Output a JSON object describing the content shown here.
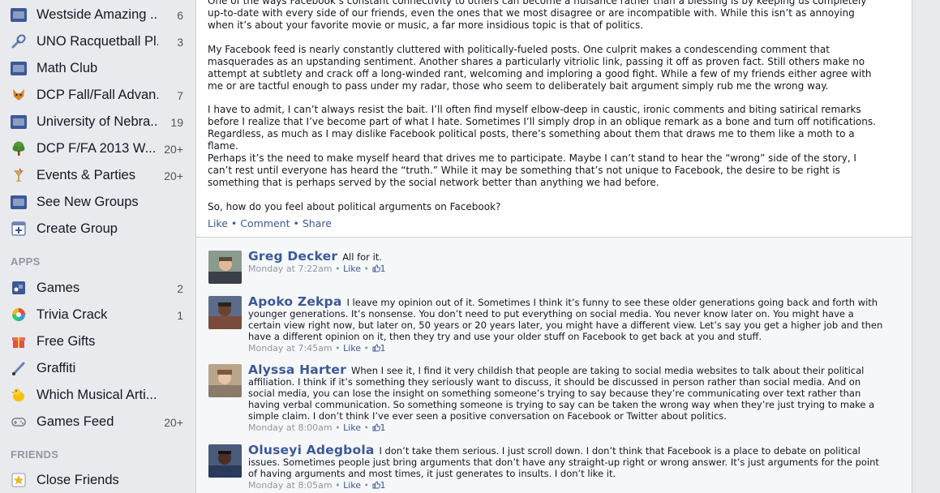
{
  "sidebar": {
    "groups": [
      {
        "label": "Westside Amazing ...",
        "count": "6",
        "icon": "group-icon"
      },
      {
        "label": "UNO Racquetball Pl...",
        "count": "3",
        "icon": "racquet-icon"
      },
      {
        "label": "Math Club",
        "count": "",
        "icon": "group-icon"
      },
      {
        "label": "DCP Fall/Fall Advan...",
        "count": "7",
        "icon": "fox-icon"
      },
      {
        "label": "University of Nebra...",
        "count": "19",
        "icon": "group-icon"
      },
      {
        "label": "DCP F/FA 2013 W...",
        "count": "20+",
        "icon": "tree-icon"
      },
      {
        "label": "Events & Parties",
        "count": "20+",
        "icon": "cup-icon"
      },
      {
        "label": "See New Groups",
        "count": "",
        "icon": "group-icon"
      },
      {
        "label": "Create Group",
        "count": "",
        "icon": "plus-icon"
      }
    ],
    "apps_header": "APPS",
    "apps": [
      {
        "label": "Games",
        "count": "2",
        "icon": "games-icon"
      },
      {
        "label": "Trivia Crack",
        "count": "1",
        "icon": "trivia-icon"
      },
      {
        "label": "Free Gifts",
        "count": "",
        "icon": "gift-icon"
      },
      {
        "label": "Graffiti",
        "count": "",
        "icon": "brush-icon"
      },
      {
        "label": "Which Musical Arti...",
        "count": "",
        "icon": "bird-icon"
      },
      {
        "label": "Games Feed",
        "count": "20+",
        "icon": "controller-icon"
      }
    ],
    "friends_header": "FRIENDS",
    "friends": [
      {
        "label": "Close Friends",
        "count": "",
        "icon": "star-icon"
      }
    ]
  },
  "post": {
    "paragraphs": [
      "One of the ways Facebook’s constant connectivity to others can become a nuisance rather than a blessing is by keeping us completely up-to-date with every side of our friends, even the ones that we most disagree or are incompatible with. While this isn’t as annoying when it’s about your favorite movie or music, a far more insidious topic is that of politics.",
      "My Facebook feed is nearly constantly cluttered with politically-fueled posts. One culprit makes a condescending comment that masquerades as an upstanding sentiment. Another shares a particularly vitriolic link, passing it off as proven fact. Still others make no attempt at subtlety and crack off a long-winded rant, welcoming and imploring a good fight. While a few of my friends either agree with me or are tactful enough to pass under my radar, those who seem to deliberately bait argument simply rub me the wrong way.",
      "I have to admit, I can’t always resist the bait. I’ll often find myself elbow-deep in caustic, ironic comments and biting satirical remarks before I realize that I’ve become part of what I hate. Sometimes I’ll simply drop in an oblique remark as a bone and turn off notifications. Regardless, as much as I may dislike Facebook political posts, there’s something about them that draws me to them like a moth to a flame.",
      "Perhaps it’s the need to make myself heard that drives me to participate. Maybe I can’t stand to hear the “wrong” side of the story, I can’t rest until everyone has heard the “truth.” While it may be something that’s not unique to Facebook, the desire to be right is something that is perhaps served by the social network better than anything we had before.",
      "So, how do you feel about political arguments on Facebook?"
    ],
    "like": "Like",
    "comment": "Comment",
    "share": "Share",
    "separator": "•"
  },
  "comments": [
    {
      "name": "Greg Decker",
      "text": "All for it.",
      "time": "Monday at 7:22am",
      "like": "Like",
      "likes": "1"
    },
    {
      "name": "Apoko Zekpa",
      "text": "I leave my opinion out of it. Sometimes I think it’s funny to see these older generations going back and forth with younger generations. It’s nonsense. You don’t need to put everything on social media. You never know later on. You might have a certain view right now, but later on, 50 years or 20 years later, you might have a different view. Let’s say you get a higher job and then have a different opinion on it, then they try and use your older stuff on Facebook to get back at you and stuff.",
      "time": "Monday at 7:45am",
      "like": "Like",
      "likes": "1"
    },
    {
      "name": "Alyssa Harter",
      "text": "When I see it, I find it very childish that people are taking to social media websites to talk about their political affiliation. I think if it’s something they seriously want to discuss, it should be discussed in person rather than social media. And on social media, you can lose the insight on something someone’s trying to say because they’re communicating over text rather than having verbal communication. So something someone is trying to say can be taken the wrong way when they’re just trying to make a simple claim. I don’t think I’ve ever seen a positive conversation on Facebook or Twitter about politics.",
      "time": "Monday at 8:00am",
      "like": "Like",
      "likes": "1"
    },
    {
      "name": "Oluseyi Adegbola",
      "text": "I don’t take them serious. I just scroll down. I don’t think that Facebook is a place to debate on political issues. Sometimes people just bring arguments that don’t have any straight-up right or wrong answer. It’s just arguments for the point of having arguments and most times, it just generates to insults. I don’t like it.",
      "time": "Monday at 8:05am",
      "like": "Like",
      "likes": "1"
    }
  ],
  "colors": {
    "link": "#3b5998",
    "sidebar_bg": "#e9eaed",
    "comments_bg": "#f6f7f8"
  }
}
